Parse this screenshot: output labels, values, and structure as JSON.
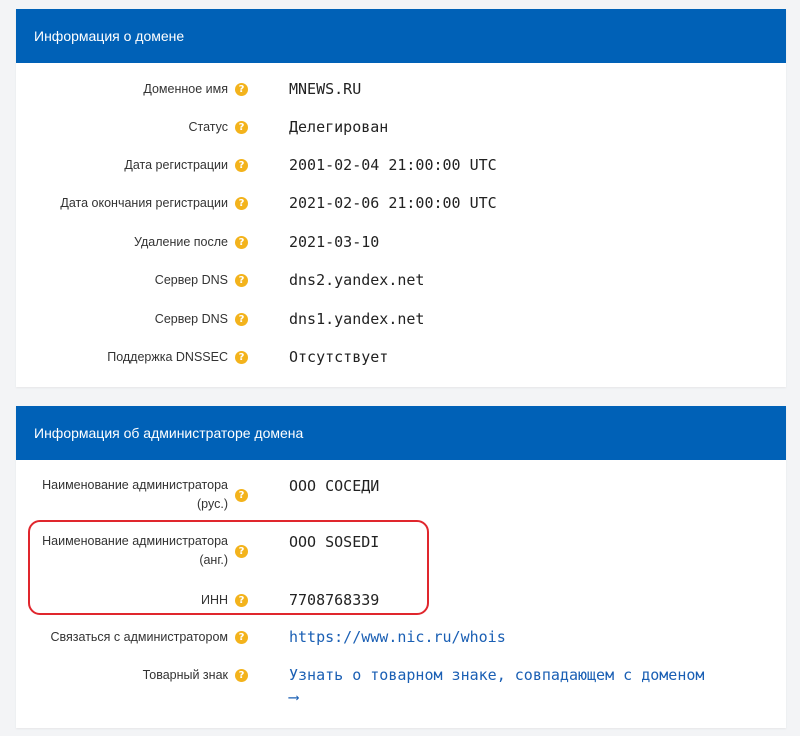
{
  "domain_info": {
    "title": "Информация о домене",
    "rows": [
      {
        "label": "Доменное имя",
        "value": "MNEWS.RU"
      },
      {
        "label": "Статус",
        "value": "Делегирован"
      },
      {
        "label": "Дата регистрации",
        "value": "2001-02-04 21:00:00 UTC"
      },
      {
        "label": "Дата окончания регистрации",
        "value": "2021-02-06 21:00:00 UTC"
      },
      {
        "label": "Удаление после",
        "value": "2021-03-10"
      },
      {
        "label": "Сервер DNS",
        "value": "dns2.yandex.net"
      },
      {
        "label": "Сервер DNS",
        "value": "dns1.yandex.net"
      },
      {
        "label": "Поддержка DNSSEC",
        "value": "Отсутствует"
      }
    ]
  },
  "admin_info": {
    "title": "Информация об администраторе домена",
    "rows": [
      {
        "label_line1": "Наименование администратора",
        "label_line2": "(рус.)",
        "value": "ООО СОСЕДИ"
      },
      {
        "label_line1": "Наименование администратора",
        "label_line2": "(анг.)",
        "value": "OOO SOSEDI"
      },
      {
        "label": "ИНН",
        "value": "7708768339"
      },
      {
        "label": "Связаться с администратором",
        "value": "https://www.nic.ru/whois"
      },
      {
        "label": "Товарный знак",
        "value_line1": "Узнать о товарном знаке, совпадающем с доменом",
        "value_line2": "⟶"
      }
    ]
  },
  "help_glyph": "?",
  "colors": {
    "header_bg": "#0061b7",
    "help_icon": "#f3b31c",
    "link": "#1a5fb4",
    "highlight": "#e0262d"
  }
}
